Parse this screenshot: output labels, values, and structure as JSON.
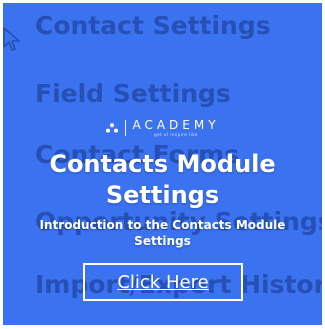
{
  "background_menu": {
    "items": [
      "Contact Settings",
      "Field Settings",
      "Contact Forms",
      "Opportunity Settings",
      "Import/Export History"
    ]
  },
  "brand": {
    "name": "ACADEMY",
    "tagline": "get ul inspire like",
    "icon": "triangle-dots-logo"
  },
  "overlay": {
    "title": "Contacts Module Settings",
    "subtitle": "Introduction to the Contacts Module Settings",
    "cta_label": "Click Here"
  },
  "colors": {
    "card_background": "#3a72f0",
    "menu_text": "#2650b6",
    "overlay_text": "#ffffff"
  }
}
